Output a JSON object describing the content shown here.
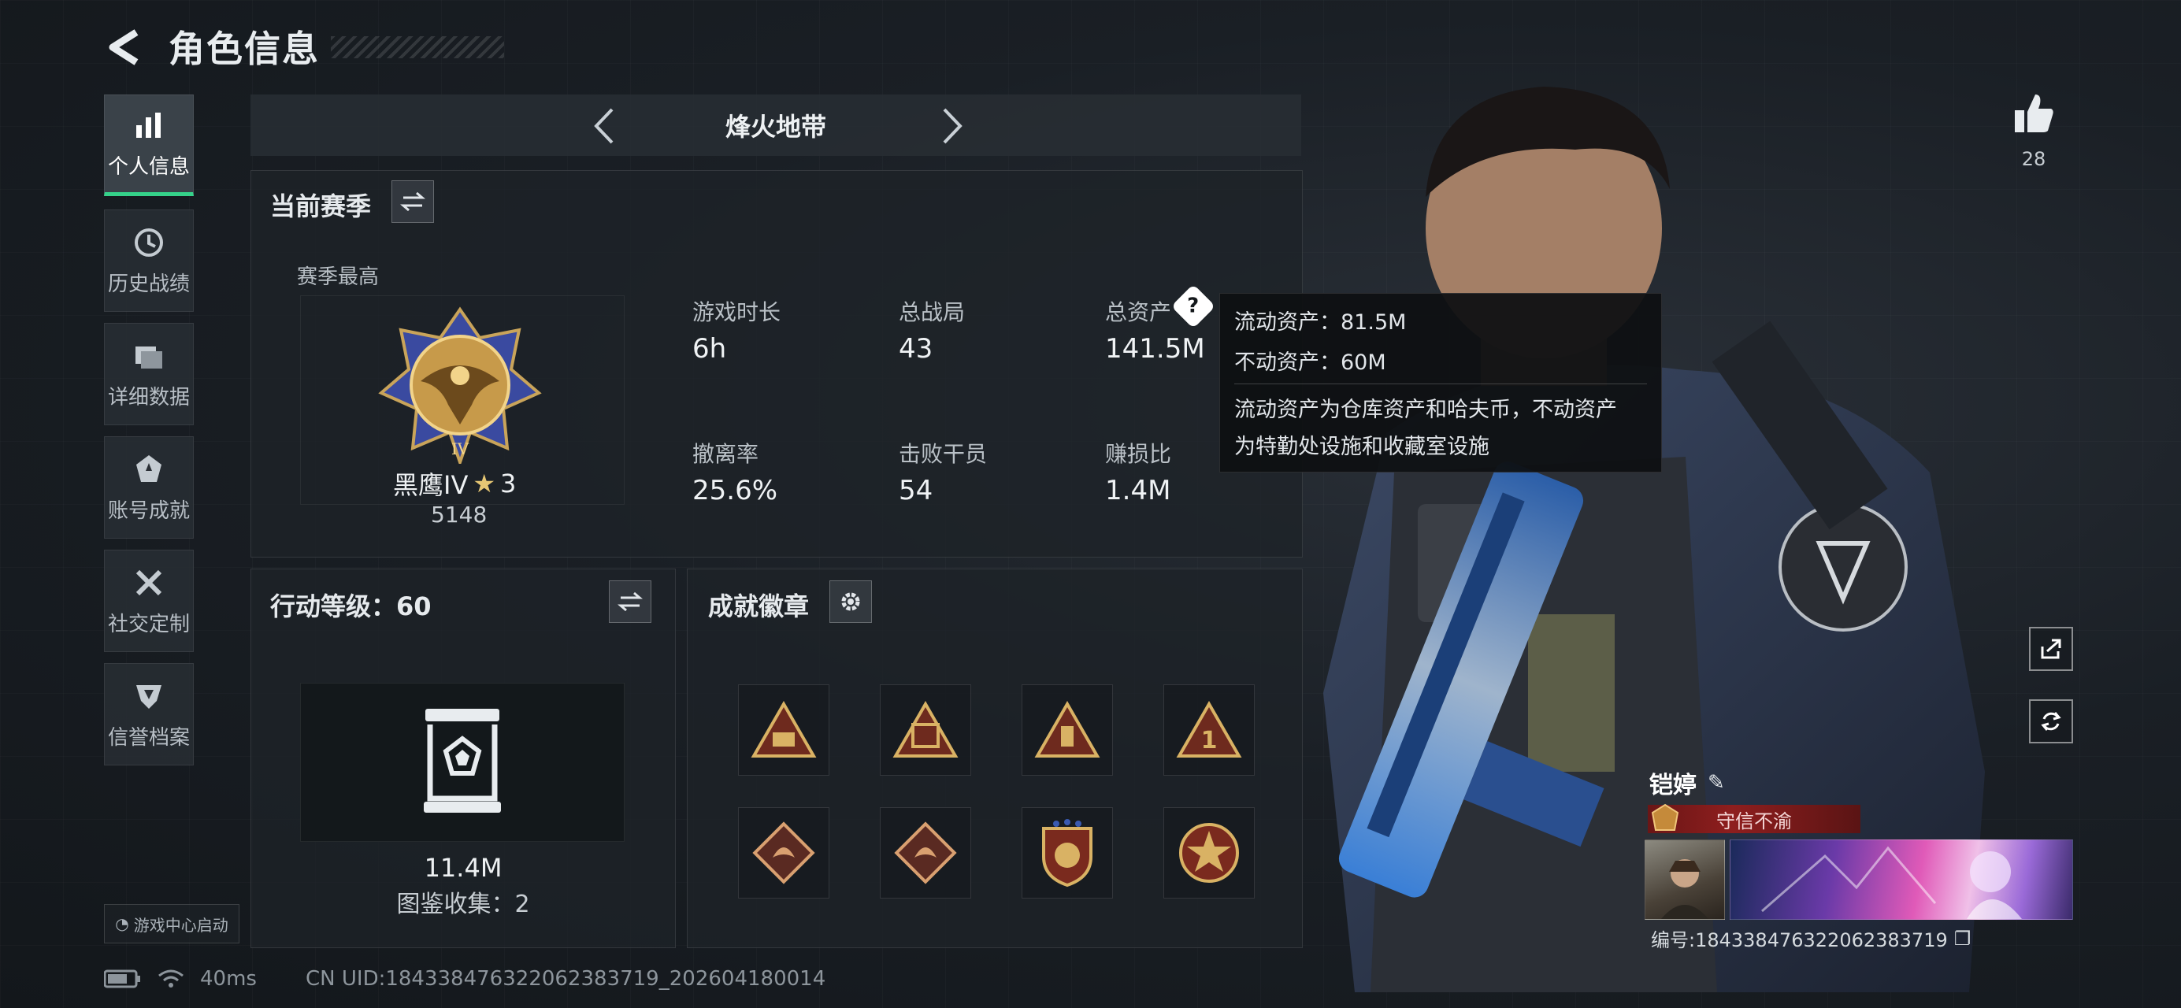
{
  "header": {
    "title": "角色信息"
  },
  "sidebar": {
    "items": [
      {
        "label": "个人信息",
        "icon": "bar-chart-icon"
      },
      {
        "label": "历史战绩",
        "icon": "clock-icon"
      },
      {
        "label": "详细数据",
        "icon": "folder-icon"
      },
      {
        "label": "账号成就",
        "icon": "achievement-icon"
      },
      {
        "label": "社交定制",
        "icon": "tools-icon"
      },
      {
        "label": "信誉档案",
        "icon": "credit-shield-icon"
      }
    ],
    "launcher_label": "游戏中心启动"
  },
  "status_bar": {
    "ping": "40ms",
    "uid": "CN UID:18433847632206238371​9_202604180014"
  },
  "season_selector": {
    "name": "烽火地带"
  },
  "current_season": {
    "title": "当前赛季",
    "highest_label": "赛季最高",
    "rank_name": "黑鹰IV",
    "rank_stars": "3",
    "rank_score": "5148",
    "stats": [
      {
        "label": "游戏时长",
        "value": "6h"
      },
      {
        "label": "总战局",
        "value": "43"
      },
      {
        "label": "总资产",
        "value": "141.5M"
      },
      {
        "label": "撤离率",
        "value": "25.6%"
      },
      {
        "label": "击败干员",
        "value": "54"
      },
      {
        "label": "赚损比",
        "value": "1.4M"
      }
    ]
  },
  "action_level": {
    "title": "行动等级：60",
    "collection_value": "11.4M",
    "collection_label": "图鉴收集：2"
  },
  "achievements": {
    "title": "成就徽章"
  },
  "tooltip": {
    "liquid": "流动资产：81.5M",
    "fixed": "不动资产：60M",
    "desc_line1": "流动资产为仓库资产和哈夫币，不动资产",
    "desc_line2": "为特勤处设施和收藏室设施"
  },
  "likes": {
    "count": "28"
  },
  "profile": {
    "name": "铠婷",
    "honor_title": "守信不渝",
    "id_text": "编号:18433847632206238371​9"
  },
  "colors": {
    "accent_green": "#35d28a",
    "honor_red": "#8e1e1e"
  }
}
